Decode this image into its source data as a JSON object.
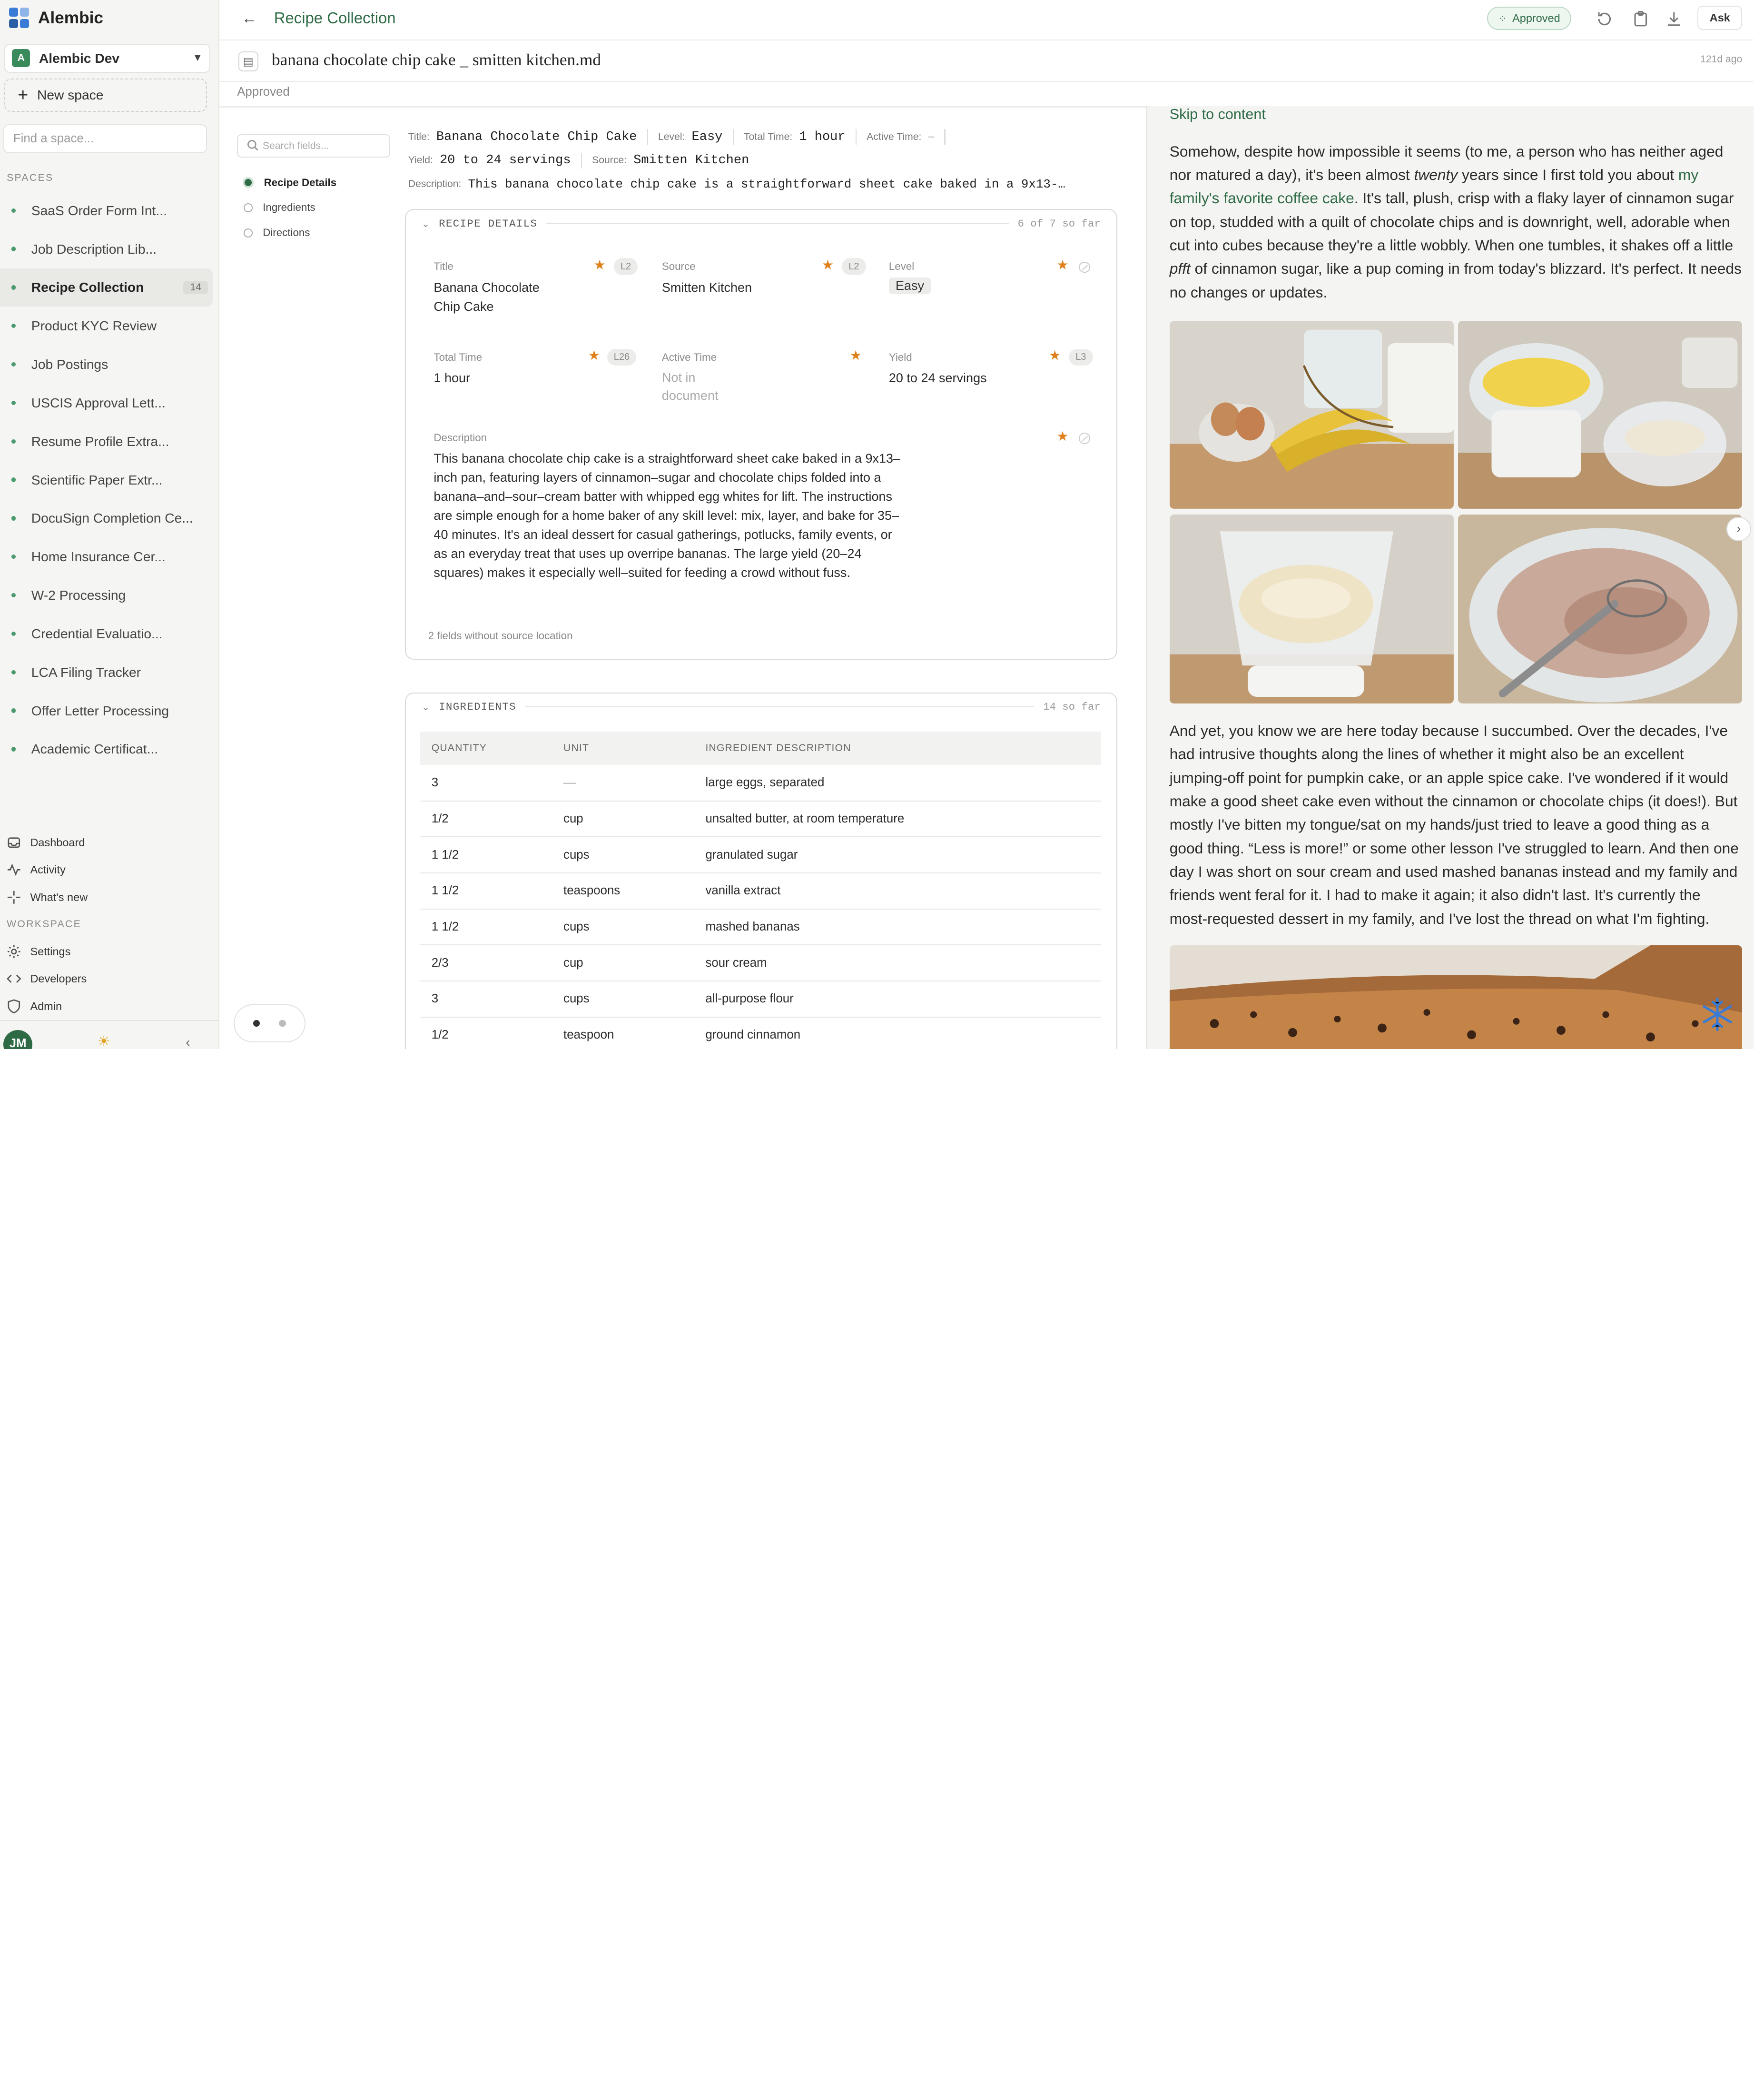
{
  "app": {
    "name": "Alembic"
  },
  "workspace": {
    "initial": "A",
    "name": "Alembic Dev"
  },
  "sidebar": {
    "new_space": "New space",
    "find_placeholder": "Find a space...",
    "spaces_label": "SPACES",
    "spaces": [
      {
        "label": "SaaS Order Form Int..."
      },
      {
        "label": "Job Description Lib..."
      },
      {
        "label": "Recipe Collection",
        "count": "14"
      },
      {
        "label": "Product KYC Review"
      },
      {
        "label": "Job Postings"
      },
      {
        "label": "USCIS Approval Lett..."
      },
      {
        "label": "Resume Profile Extra..."
      },
      {
        "label": "Scientific Paper Extr..."
      },
      {
        "label": "DocuSign Completion Ce..."
      },
      {
        "label": "Home Insurance Cer..."
      },
      {
        "label": "W-2 Processing"
      },
      {
        "label": "Credential Evaluatio..."
      },
      {
        "label": "LCA Filing Tracker"
      },
      {
        "label": "Offer Letter Processing"
      },
      {
        "label": "Academic Certificat..."
      }
    ],
    "nav": {
      "dashboard": "Dashboard",
      "activity": "Activity",
      "whats_new": "What's new"
    },
    "workspace_label": "WORKSPACE",
    "workspace_nav": {
      "settings": "Settings",
      "developers": "Developers",
      "admin": "Admin"
    },
    "user_initials": "JM"
  },
  "topbar": {
    "breadcrumb": "Recipe Collection",
    "status": "Approved",
    "ask": "Ask"
  },
  "file": {
    "name": "banana chocolate chip cake _ smitten kitchen.md",
    "age": "121d ago",
    "status": "Approved"
  },
  "fields_panel": {
    "search_placeholder": "Search fields...",
    "toc": [
      "Recipe Details",
      "Ingredients",
      "Directions"
    ]
  },
  "summary": {
    "title_label": "Title:",
    "title": "Banana Chocolate Chip Cake",
    "level_label": "Level:",
    "level": "Easy",
    "total_time_label": "Total Time:",
    "total_time": "1 hour",
    "active_time_label": "Active Time:",
    "active_time": "—",
    "yield_label": "Yield:",
    "yield": "20 to 24 servings",
    "source_label": "Source:",
    "source": "Smitten Kitchen",
    "description_label": "Description:",
    "description": "This banana chocolate chip cake is a straightforward sheet cake baked in a 9x13-…"
  },
  "recipe_details": {
    "heading": "RECIPE DETAILS",
    "progress": "6 of 7 so far",
    "fields": {
      "title": {
        "label": "Title",
        "value": "Banana Chocolate Chip Cake",
        "tag": "L2"
      },
      "source": {
        "label": "Source",
        "value": "Smitten Kitchen",
        "tag": "L2"
      },
      "level": {
        "label": "Level",
        "value": "Easy"
      },
      "total_time": {
        "label": "Total Time",
        "value": "1 hour",
        "tag": "L26"
      },
      "active_time": {
        "label": "Active Time",
        "value": "Not in document"
      },
      "yield": {
        "label": "Yield",
        "value": "20 to 24 servings",
        "tag": "L3"
      },
      "description": {
        "label": "Description",
        "value": "This banana chocolate chip cake is a straightforward sheet cake baked in a 9x13–inch pan, featuring layers of cinnamon–sugar and chocolate chips folded into a banana–and–sour–cream batter with whipped egg whites for lift. The instructions are simple enough for a home baker of any skill level: mix, layer, and bake for 35–40 minutes. It's an ideal dessert for casual gatherings, potlucks, family events, or as an everyday treat that uses up overripe bananas. The large yield (20–24 squares) makes it especially well–suited for feeding a crowd without fuss."
      }
    },
    "footer": "2 fields without source location"
  },
  "ingredients": {
    "heading": "INGREDIENTS",
    "progress": "14 so far",
    "columns": [
      "QUANTITY",
      "UNIT",
      "INGREDIENT DESCRIPTION"
    ],
    "rows": [
      [
        "3",
        "—",
        "large eggs, separated"
      ],
      [
        "1/2",
        "cup",
        "unsalted butter, at room temperature"
      ],
      [
        "1 1/2",
        "cups",
        "granulated sugar"
      ],
      [
        "1 1/2",
        "teaspoons",
        "vanilla extract"
      ],
      [
        "1 1/2",
        "cups",
        "mashed bananas"
      ],
      [
        "2/3",
        "cup",
        "sour cream"
      ],
      [
        "3",
        "cups",
        "all-purpose flour"
      ],
      [
        "1/2",
        "teaspoon",
        "ground cinnamon"
      ]
    ]
  },
  "preview": {
    "skip": "Skip to content",
    "p1_a": "Somehow, despite how impossible it seems (to me, a person who has neither aged nor matured a day), it's been almost ",
    "p1_em": "twenty",
    "p1_b": " years since I first told you about ",
    "p1_link": "my family's favorite coffee cake",
    "p1_c": ". It's tall, plush, crisp with a flaky layer of cinnamon sugar on top, studded with a quilt of chocolate chips and is downright, well, adorable when cut into cubes because they're a little wobbly. When one tumbles, it shakes off a little ",
    "p1_em2": "pfft",
    "p1_d": " of cinnamon sugar, like a pup coming in from today's blizzard. It's perfect. It needs no changes or updates.",
    "p2": "And yet, you know we are here today because I succumbed. Over the decades, I've had intrusive thoughts along the lines of whether it might also be an excellent jumping-off point for pumpkin cake, or an apple spice cake. I've wondered if it would make a good sheet cake even without the cinnamon or chocolate chips (it does!). But mostly I've bitten my tongue/sat on my hands/just tried to leave a good thing as a good thing. “Less is more!” or some other lesson I've struggled to learn. And then one day I was short on sour cream and used mashed bananas instead and my family and friends went feral for it. I had to make it again; it also didn't last. It's currently the most-requested dessert in my family, and I've lost the thread on what I'm fighting."
  },
  "colors": {
    "accent": "#2e6b45",
    "star": "#e0801a",
    "sidebar_bg": "#f5f5f3"
  }
}
